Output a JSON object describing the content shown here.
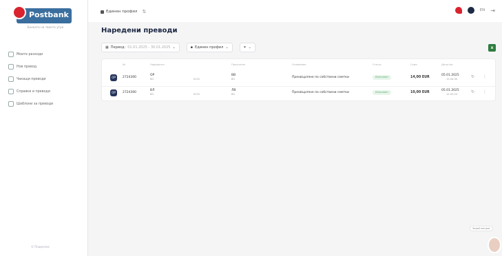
{
  "brand": {
    "name": "Postbank",
    "tagline": "Банката на твоето утре"
  },
  "sidebar": {
    "items": [
      {
        "label": "Моите разходи"
      },
      {
        "label": "Нов превод"
      },
      {
        "label": "Чакащи преводи"
      },
      {
        "label": "Справки и преводи"
      },
      {
        "label": "Шаблони за преводи"
      }
    ],
    "footer": "© Пощенска"
  },
  "topbar": {
    "profile": "Единен профил",
    "lang": "EN"
  },
  "page": {
    "title": "Наредени преводи"
  },
  "filters": {
    "period_label": "Период:",
    "period_value": "01.01.2025 - 30.01.2025",
    "profile_value": "Единен профил"
  },
  "table": {
    "columns": [
      "№",
      "Наредител",
      "Получател",
      "Основание",
      "Статус",
      "Сума",
      "Дата/час"
    ],
    "rows": [
      {
        "icon": "OP",
        "number": "2724300",
        "payer": "ОР",
        "payer_sub": "BG",
        "payer_acc": "0231",
        "payee": "ВВ",
        "payee_sub": "BG",
        "reason": "Прехвърляне по собствени сметки",
        "status": "Изпълнен",
        "amount": "14,00 EUR",
        "date": "05.01.2025",
        "time": "12:44:30"
      },
      {
        "icon": "OP",
        "number": "2724300",
        "payer": "ВЛ",
        "payer_sub": "BG",
        "payer_acc": "0231",
        "payee": "ЛВ",
        "payee_sub": "BG",
        "reason": "Прехвърляне по собствени сметки",
        "status": "Изпълнен",
        "amount": "10,00 EUR",
        "date": "05.01.2025",
        "time": "12:43:24"
      }
    ]
  },
  "chat": {
    "label": "Задай въпрос"
  }
}
